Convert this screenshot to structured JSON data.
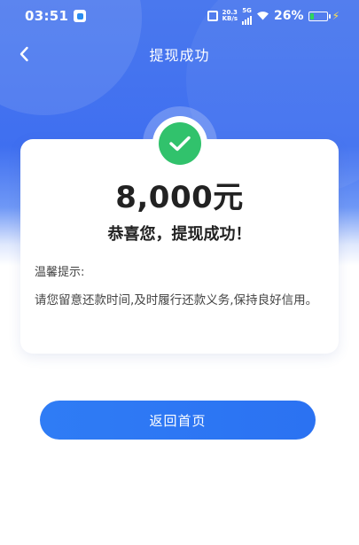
{
  "status_bar": {
    "time": "03:51",
    "net_speed": "20.3",
    "net_unit": "KB/s",
    "network_type": "5G",
    "battery_percent": "26%",
    "battery_level": 0.26
  },
  "nav": {
    "title": "提现成功"
  },
  "result": {
    "amount": "8,000元",
    "message": "恭喜您，提现成功！"
  },
  "tip": {
    "title": "温馨提示:",
    "body": "请您留意还款时间,及时履行还款义务,保持良好信用。"
  },
  "actions": {
    "home_label": "返回首页"
  },
  "colors": {
    "primary": "#2f7cf5",
    "success": "#31c26c",
    "header_blue": "#4a78ee"
  }
}
